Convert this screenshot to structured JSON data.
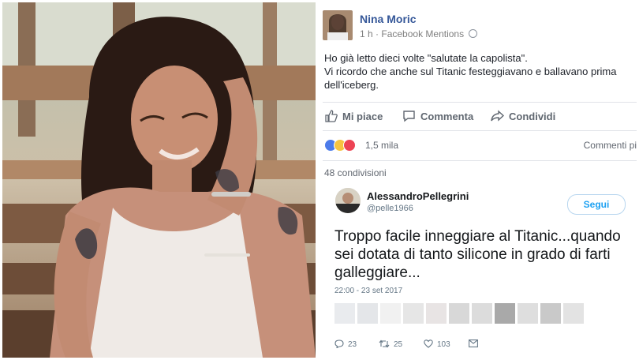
{
  "facebook_post": {
    "author": "Nina Moric",
    "time": "1 h",
    "separator": "·",
    "via": "Facebook Mentions",
    "text_lines": [
      "Ho già letto dieci volte \"salutate la capolista\".",
      "Vi ricordo che anche sul Titanic festeggiavano e ballavano prima",
      "dell'iceberg."
    ],
    "actions": {
      "like": "Mi piace",
      "comment": "Commenta",
      "share": "Condividi"
    },
    "reactions_count": "1,5 mila",
    "comments_link": "Commenti pi",
    "shares": "48 condivisioni",
    "colors": {
      "link": "#365899",
      "like_blue": "#4c7bea",
      "haha_yellow": "#f7c440",
      "love_red": "#ed4354"
    }
  },
  "tweet": {
    "name": "AlessandroPellegrini",
    "handle": "@pelle1966",
    "follow_label": "Segui",
    "text_lines": [
      "Troppo facile inneggiare al Titanic...quando",
      "sei dotata di tanto silicone in grado di farti",
      "galleggiare..."
    ],
    "timestamp": "22:00 - 23 set 2017",
    "liker_colors": [
      "#e9ebee",
      "#e4e6e9",
      "#f1f1f1",
      "#e6e6e6",
      "#e8e4e4",
      "#d8d8d8",
      "#dcdcdc",
      "#a9a9a9",
      "#dedede",
      "#c9c9c9",
      "#e3e3e3"
    ],
    "counts": {
      "replies": "23",
      "retweets": "25",
      "likes": "103"
    },
    "colors": {
      "follow_blue": "#1da1f2"
    }
  }
}
